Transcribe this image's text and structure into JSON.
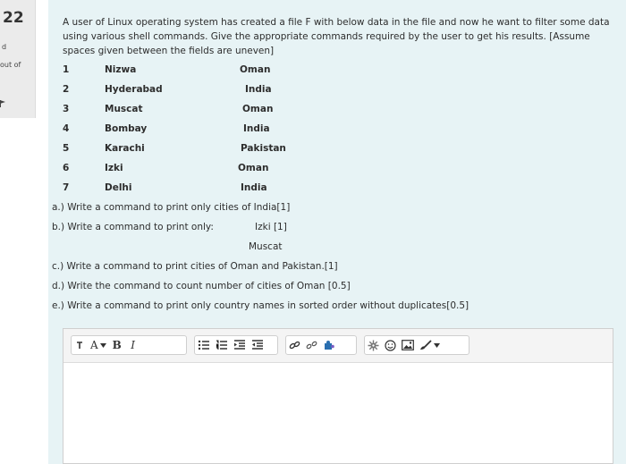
{
  "info": {
    "number": "22",
    "status": "d",
    "marks": "out of"
  },
  "question": {
    "intro": "A user of Linux operating system has created a file F with below data in the file and now he want to filter some data using various shell commands. Give the appropriate commands required by the user to get his results.    [Assume spaces given between the fields are uneven]",
    "rows": [
      {
        "num": "1",
        "city": "Nizwa",
        "country": "Oman"
      },
      {
        "num": "2",
        "city": "Hyderabad",
        "country": "India"
      },
      {
        "num": "3",
        "city": "Muscat",
        "country": "Oman"
      },
      {
        "num": "4",
        "city": "Bombay",
        "country": "India"
      },
      {
        "num": "5",
        "city": "Karachi",
        "country": "Pakistan"
      },
      {
        "num": "6",
        "city": "Izki",
        "country": "Oman"
      },
      {
        "num": "7",
        "city": "Delhi",
        "country": "India"
      }
    ],
    "part_a": "a.)  Write a command to print only cities of India[1]",
    "part_b": "b.)  Write a command to print only:",
    "part_b_izki": "Izki   [1]",
    "part_b_muscat": "Muscat",
    "part_c": "c.)  Write a command to print cities of Oman and Pakistan.[1]",
    "part_d": "d.)  Write the command to count number of cities of Oman [0.5]",
    "part_e": "e.)  Write a command to print only country names in sorted order without duplicates[0.5]"
  },
  "toolbar": {
    "format_label": "A",
    "bold_label": "B",
    "italic_label": "I"
  },
  "colors": {
    "question_bg": "#e7f3f5",
    "info_bg": "#ebebeb",
    "link_icon": "#2a6fb0",
    "accent_icon": "#7a5cc4"
  }
}
